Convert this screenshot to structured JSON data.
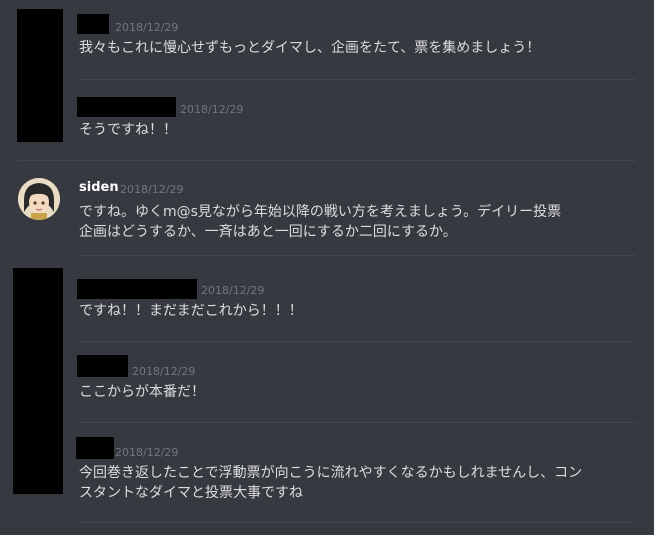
{
  "messages": [
    {
      "timestamp": "2018/12/29",
      "text": "我々もこれに慢心せずもっとダイマし、企画をたて、票を集めましょう！"
    },
    {
      "timestamp": "2018/12/29",
      "text": "そうですね！！"
    },
    {
      "author": "siden",
      "timestamp": "2018/12/29",
      "text": "ですね。ゆくm@s見ながら年始以降の戦い方を考えましょう。デイリー投票\n企画はどうするか、一斉はあと一回にするか二回にするか。"
    },
    {
      "timestamp": "2018/12/29",
      "text": "ですね！！まだまだこれから！！！"
    },
    {
      "timestamp": "2018/12/29",
      "text": "ここからが本番だ！"
    },
    {
      "timestamp": "2018/12/29",
      "text": "今回巻き返したことで浮動票が向こうに流れやすくなるかもしれませんし、コン\nスタントなダイマと投票大事ですね"
    }
  ]
}
